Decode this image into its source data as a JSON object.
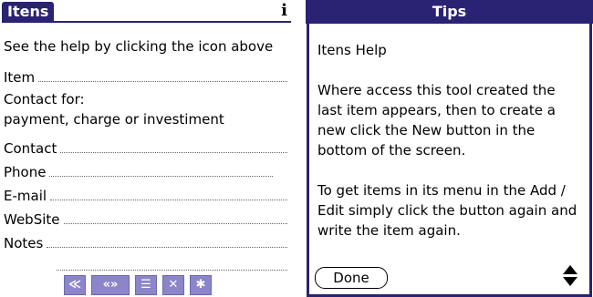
{
  "left": {
    "title": "Itens",
    "info_icon": "i",
    "help_text": "See the help by clicking the icon above",
    "item_label": "Item",
    "contact_for_line1": "Contact for:",
    "contact_for_line2": "payment, charge or investiment",
    "contact_label": "Contact",
    "phone_label": "Phone",
    "email_label": "E-mail",
    "website_label": "WebSite",
    "notes_label": "Notes",
    "toolbar": [
      {
        "name": "first-record-icon",
        "glyph": "≪"
      },
      {
        "name": "prev-next-icon",
        "glyph": "«»"
      },
      {
        "name": "filter-icon",
        "glyph": "☰"
      },
      {
        "name": "delete-icon",
        "glyph": "✕"
      },
      {
        "name": "snowflake-icon",
        "glyph": "✱"
      }
    ]
  },
  "tips": {
    "title": "Tips",
    "heading": "Itens Help",
    "paragraph1": "Where access this tool created the last item appears, then to create a new click the New button in the bottom of the screen.",
    "paragraph2": "To get items in its menu in the Add / Edit simply click the button again and write the item again.",
    "done_label": "Done"
  },
  "colors": {
    "accent": "#2a2373",
    "toolbar_button": "#8b86c9"
  }
}
